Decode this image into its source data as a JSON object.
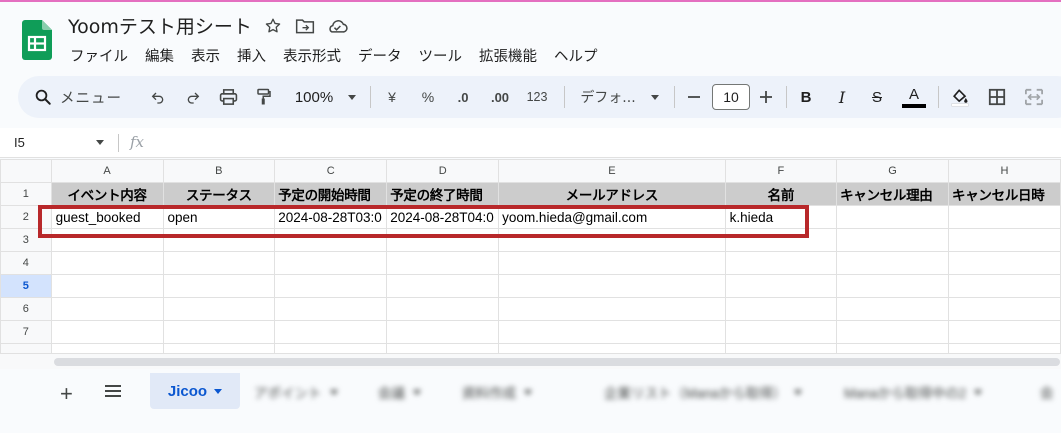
{
  "app": {
    "title": "Yoomテスト用シート",
    "menu": [
      "ファイル",
      "編集",
      "表示",
      "挿入",
      "表示形式",
      "データ",
      "ツール",
      "拡張機能",
      "ヘルプ"
    ]
  },
  "toolbar": {
    "search_label": "メニュー",
    "zoom": "100%",
    "currency": "¥",
    "percent": "%",
    "dec_decrease": ".0",
    "dec_increase": ".00",
    "number_format": "123",
    "font_name": "デフォ...",
    "font_size": "10",
    "bold": "B",
    "italic": "I",
    "strike": "S",
    "text_color_letter": "A"
  },
  "formula_bar": {
    "cell_ref": "I5",
    "fx": "fx"
  },
  "grid": {
    "col_headers": [
      "A",
      "B",
      "C",
      "D",
      "E",
      "F",
      "G",
      "H"
    ],
    "row_headers": [
      "1",
      "2",
      "3",
      "4",
      "5",
      "6",
      "7"
    ],
    "selected_row": "5",
    "header_row": [
      "イベント内容",
      "ステータス",
      "予定の開始時間",
      "予定の終了時間",
      "メールアドレス",
      "名前",
      "キャンセル理由",
      "キャンセル日時"
    ],
    "data_row": [
      "guest_booked",
      "open",
      "2024-08-28T03:0",
      "2024-08-28T04:0",
      "yoom.hieda@gmail.com",
      "k.hieda",
      "",
      ""
    ]
  },
  "tabs": {
    "add": "+",
    "active": "Jicoo",
    "blurred": [
      "アポイント",
      "会議",
      "資料作成",
      "企業リスト（Manaから取得）",
      "Manaから取得中の2",
      "会"
    ]
  },
  "colors": {
    "highlight": "#b8282a",
    "active_tab": "#0b57d0",
    "header_fill": "#cccccc",
    "logo": "#0f9d58"
  }
}
